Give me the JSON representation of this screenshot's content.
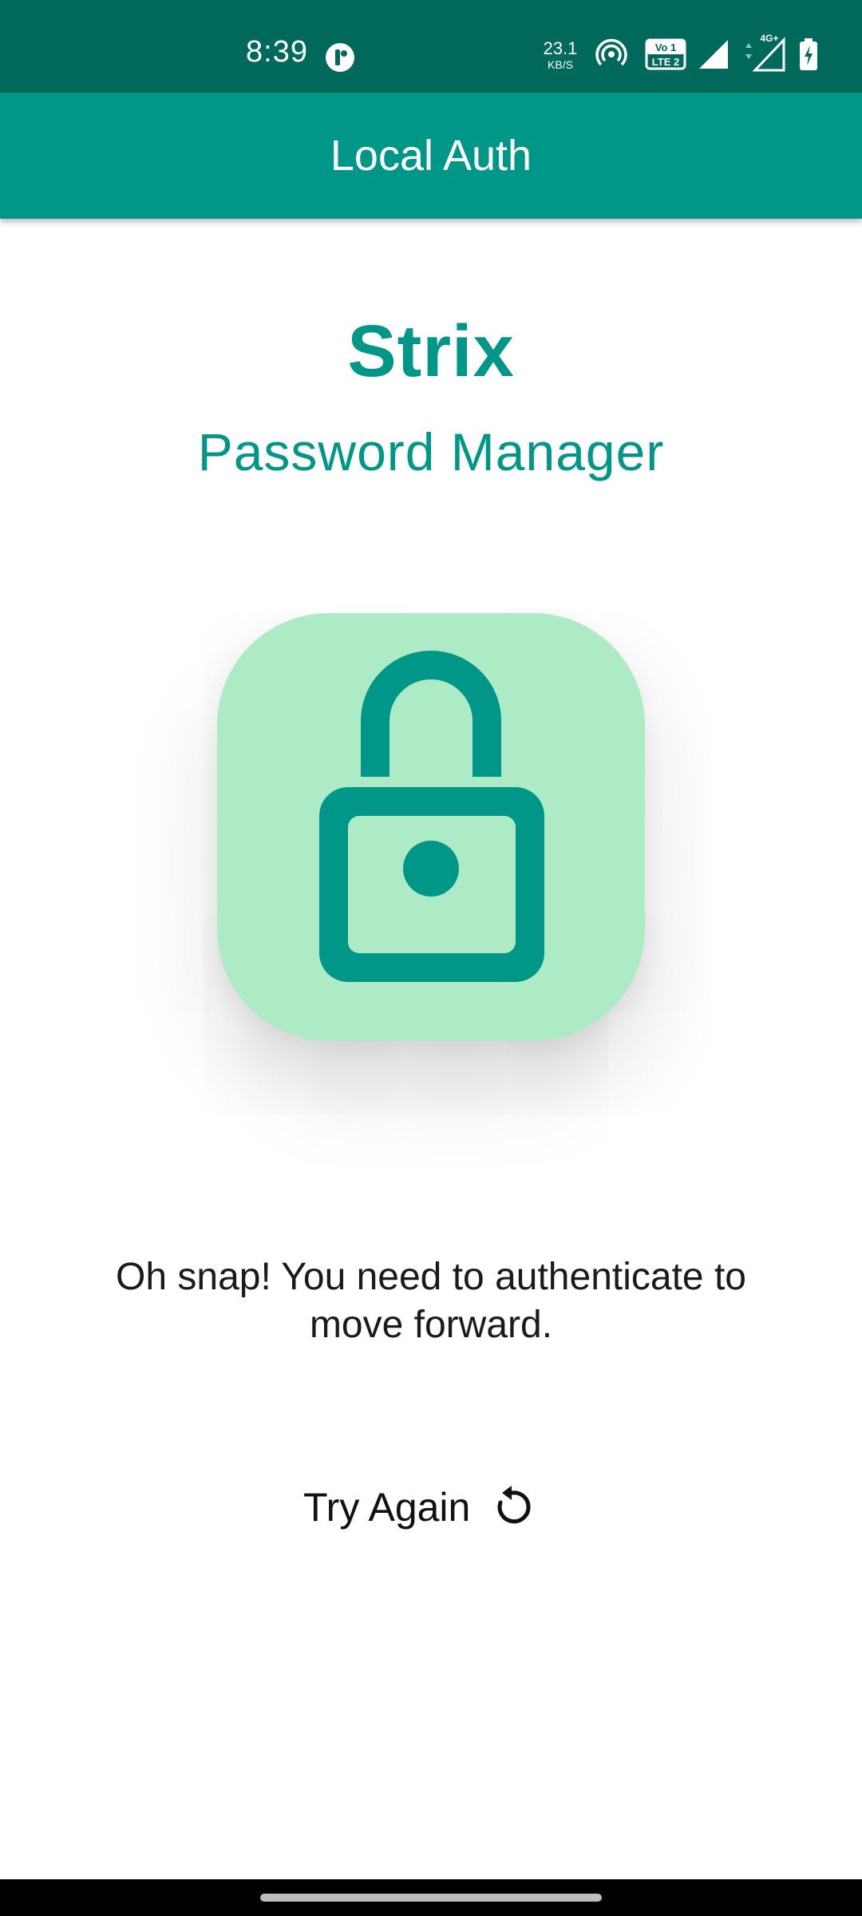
{
  "status_bar": {
    "time": "8:39",
    "network_speed": "23.1",
    "network_speed_unit": "KB/S",
    "volte_label": "Vo LTE",
    "network_type": "4G+"
  },
  "app_bar": {
    "title": "Local Auth"
  },
  "brand": {
    "title": "Strix",
    "subtitle": "Password Manager"
  },
  "lock": {
    "icon": "lock-icon",
    "tile_color": "#adebc6",
    "icon_color": "#009688"
  },
  "message": "Oh snap! You need to authenticate to move forward.",
  "action": {
    "label": "Try Again",
    "icon": "refresh-icon"
  },
  "colors": {
    "status_bar": "#00695c",
    "app_bar": "#009688",
    "accent": "#009688"
  }
}
